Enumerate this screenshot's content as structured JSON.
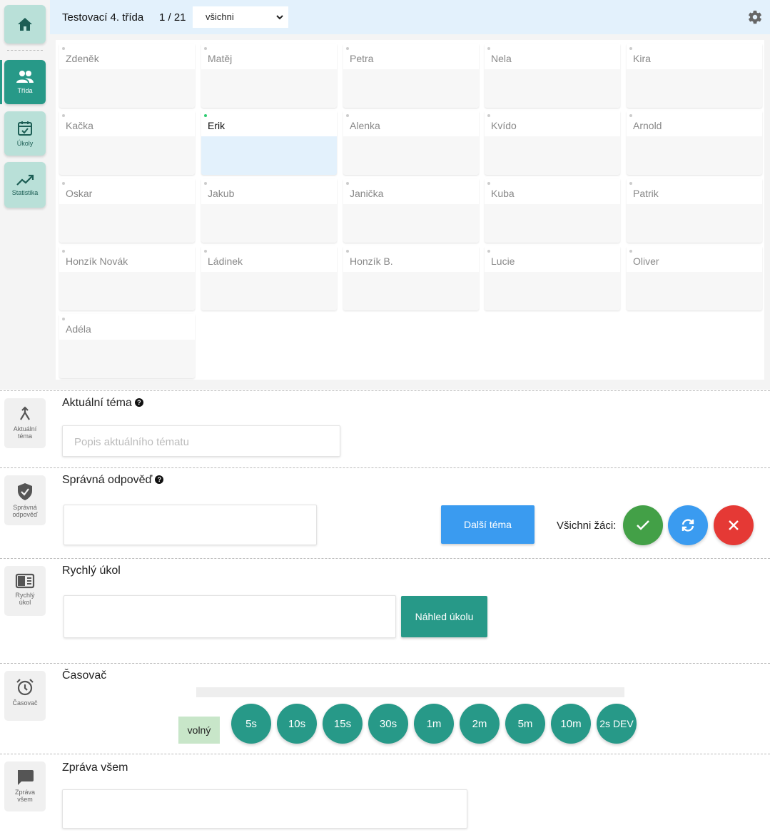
{
  "sidebar": {
    "items": [
      {
        "label": "",
        "icon": "home-icon"
      },
      {
        "label": "Třída",
        "icon": "users-icon"
      },
      {
        "label": "Úkoly",
        "icon": "calendar-check-icon"
      },
      {
        "label": "Statistika",
        "icon": "trending-icon"
      }
    ]
  },
  "header": {
    "class_title": "Testovací 4. třída",
    "counter": "1 / 21",
    "filter_selected": "všichni"
  },
  "students": [
    "Zdeněk",
    "Matěj",
    "Petra",
    "Nela",
    "Kira",
    "Kačka",
    "Erik",
    "Alenka",
    "Kvído",
    "Arnold",
    "Oskar",
    "Jakub",
    "Janička",
    "Kuba",
    "Patrik",
    "Honzík Novák",
    "Ládinek",
    "Honzík B.",
    "Lucie",
    "Oliver",
    "Adéla"
  ],
  "topic": {
    "icon_label_1": "Aktuální",
    "icon_label_2": "téma",
    "title": "Aktuální téma",
    "placeholder": "Popis aktuálního tématu"
  },
  "answer": {
    "icon_label_1": "Správná",
    "icon_label_2": "odpověď",
    "title": "Správná odpověď",
    "next_button": "Další téma",
    "all_students_label": "Všichni žáci:"
  },
  "quick_task": {
    "icon_label_1": "Rychlý",
    "icon_label_2": "úkol",
    "title": "Rychlý úkol",
    "preview_button": "Náhled úkolu"
  },
  "timer": {
    "icon_label": "Časovač",
    "title": "Časovač",
    "free_label": "volný",
    "buttons": [
      "5s",
      "10s",
      "15s",
      "30s",
      "1m",
      "2m",
      "5m",
      "10m",
      "2s DEV"
    ]
  },
  "message": {
    "icon_label_1": "Zpráva",
    "icon_label_2": "všem",
    "title": "Zpráva všem"
  },
  "colors": {
    "accent": "#279988",
    "blue": "#3a9bf0",
    "green": "#43a047",
    "red": "#e53935",
    "header_bg": "#e3f1fc"
  }
}
